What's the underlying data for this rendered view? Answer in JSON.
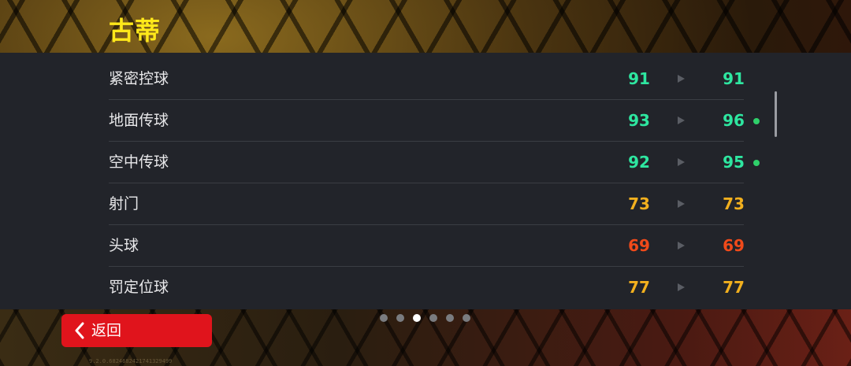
{
  "header": {
    "player_name": "古蒂"
  },
  "stats": [
    {
      "label": "紧密控球",
      "before": "91",
      "after": "91",
      "color": "#2ee6a0",
      "upgraded": false
    },
    {
      "label": "地面传球",
      "before": "93",
      "after": "96",
      "color": "#2ee6a0",
      "upgraded": true
    },
    {
      "label": "空中传球",
      "before": "92",
      "after": "95",
      "color": "#2ee6a0",
      "upgraded": true
    },
    {
      "label": "射门",
      "before": "73",
      "after": "73",
      "color": "#f2b01e",
      "upgraded": false
    },
    {
      "label": "头球",
      "before": "69",
      "after": "69",
      "color": "#f04a1a",
      "upgraded": false
    },
    {
      "label": "罚定位球",
      "before": "77",
      "after": "77",
      "color": "#f2b01e",
      "upgraded": false
    }
  ],
  "pager": {
    "count": 6,
    "active_index": 2
  },
  "footer": {
    "back_label": "返回",
    "version": "9.2.0.6824682421741329499"
  },
  "colors": {
    "accent_red": "#e0141c",
    "name_yellow": "#ffe81a",
    "upgrade_dot": "#2fd06a"
  }
}
